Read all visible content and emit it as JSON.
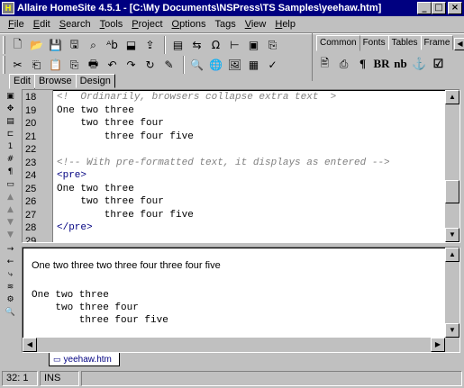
{
  "window": {
    "title": "Allaire HomeSite 4.5.1 - [C:\\My Documents\\NSPress\\TS Samples\\yeehaw.htm]",
    "minimize": "_",
    "maximize": "□",
    "close": "×"
  },
  "menu": [
    {
      "key": "F",
      "rest": "ile"
    },
    {
      "key": "E",
      "rest": "dit"
    },
    {
      "key": "S",
      "rest": "earch"
    },
    {
      "key": "T",
      "rest": "ools"
    },
    {
      "key": "P",
      "rest": "roject"
    },
    {
      "key": "O",
      "rest": "ptions"
    },
    {
      "key": "",
      "rest": "Tags"
    },
    {
      "key": "V",
      "rest": "iew"
    },
    {
      "key": "H",
      "rest": "elp"
    }
  ],
  "tag_toolbar": {
    "tabs": [
      "Common",
      "Fonts",
      "Tables",
      "Frame"
    ],
    "active": "Common",
    "buttons": [
      "¶",
      "BR",
      "nb",
      "⚓",
      "☑"
    ]
  },
  "view_tabs": [
    "Edit",
    "Browse",
    "Design"
  ],
  "active_view": "Edit",
  "editor": {
    "lines": [
      {
        "n": "18",
        "text": "<!  Ordinarily, browsers collapse extra text  >",
        "kind": "comment"
      },
      {
        "n": "19",
        "text": "One two three",
        "kind": "text"
      },
      {
        "n": "20",
        "text": "    two three four",
        "kind": "text"
      },
      {
        "n": "21",
        "text": "        three four five",
        "kind": "text"
      },
      {
        "n": "22",
        "text": "",
        "kind": "text"
      },
      {
        "n": "23",
        "text": "<!-- With pre-formatted text, it displays as entered -->",
        "kind": "comment"
      },
      {
        "n": "24",
        "text": "<pre>",
        "kind": "tag"
      },
      {
        "n": "25",
        "text": "One two three",
        "kind": "text"
      },
      {
        "n": "26",
        "text": "    two three four",
        "kind": "text"
      },
      {
        "n": "27",
        "text": "        three four five",
        "kind": "text"
      },
      {
        "n": "28",
        "text": "</pre>",
        "kind": "tag"
      },
      {
        "n": "29",
        "text": "",
        "kind": "text"
      }
    ]
  },
  "browser": {
    "rendered_line": "One two three two three four three four five",
    "pre_text": "One two three\n    two three four\n        three four five"
  },
  "document_tab": "yeehaw.htm",
  "status": {
    "position": "32: 1",
    "mode": "INS"
  }
}
